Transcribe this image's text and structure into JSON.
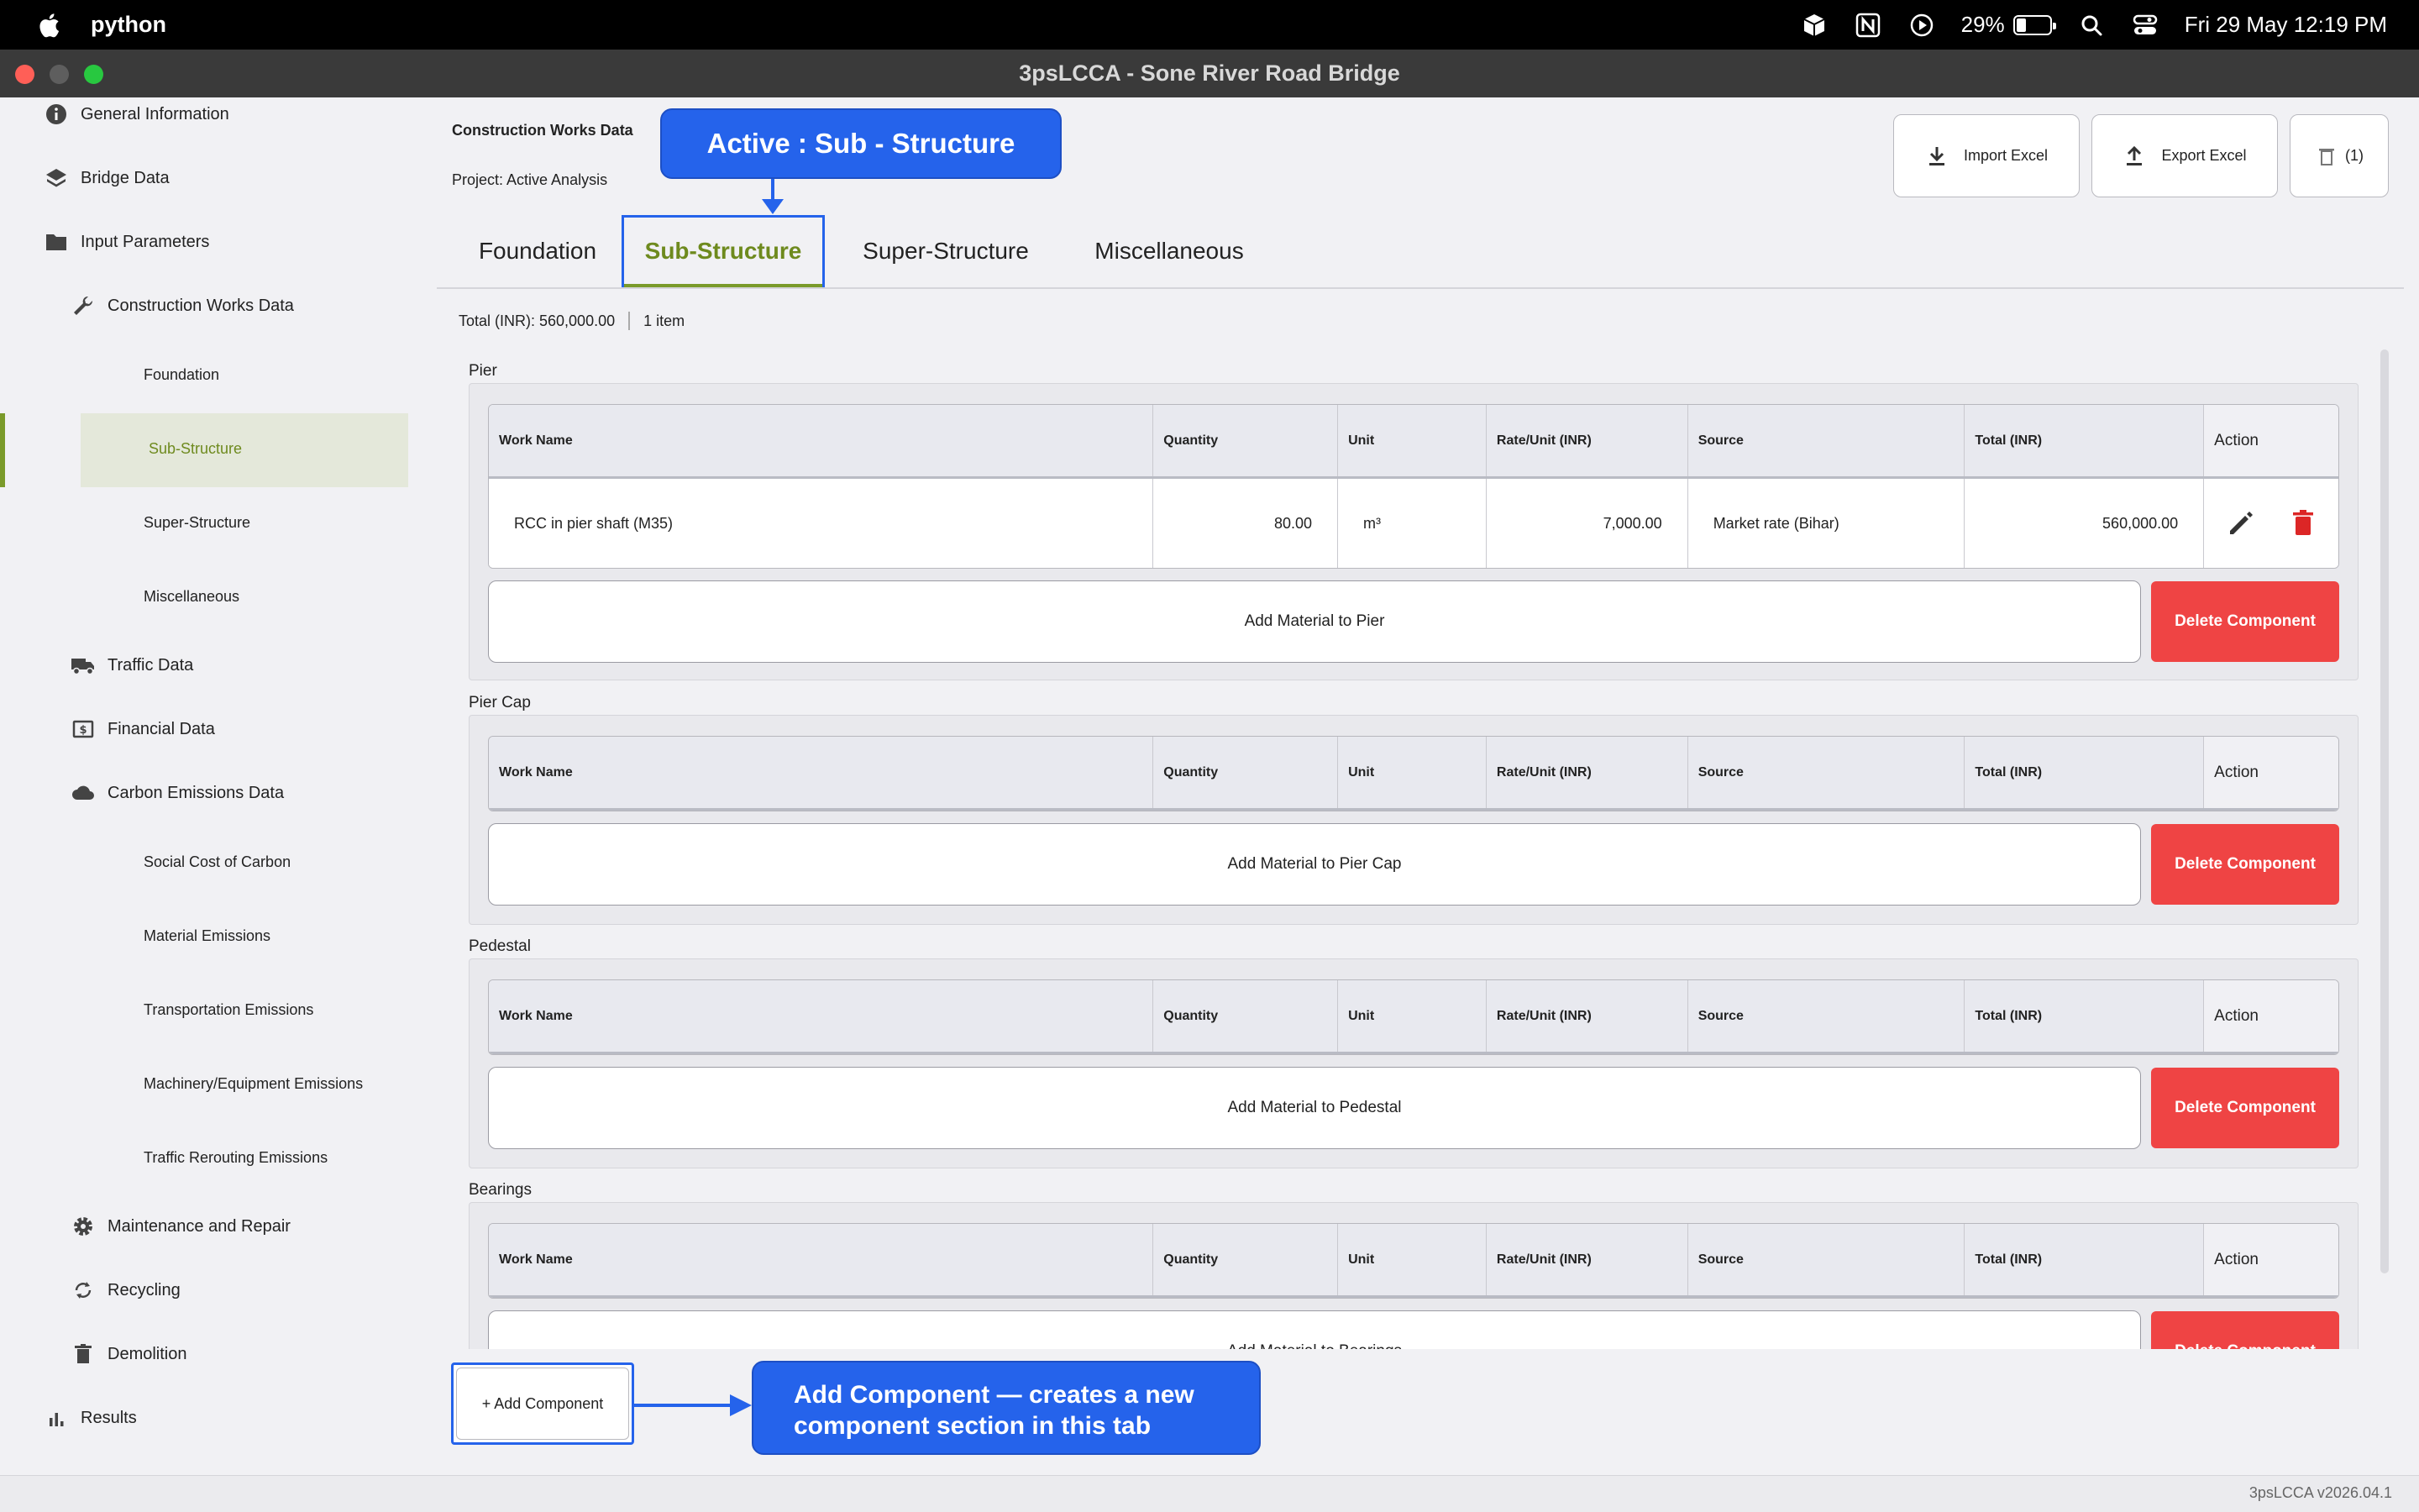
{
  "menubar": {
    "app_name": "python",
    "battery_percent": "29%",
    "battery_level": 0.29,
    "datetime": "Fri 29 May  12:19 PM",
    "icons": [
      "apple-icon",
      "cube-icon",
      "notion-icon",
      "play-circle-icon",
      "battery-icon",
      "search-icon",
      "control-center-icon"
    ]
  },
  "window": {
    "title": "3psLCCA - Sone River Road Bridge"
  },
  "sidebar": {
    "general_information": "General Information",
    "bridge_data": "Bridge Data",
    "input_parameters": "Input Parameters",
    "construction_works_data": "Construction Works Data",
    "foundation": "Foundation",
    "sub_structure": "Sub-Structure",
    "super_structure": "Super-Structure",
    "miscellaneous": "Miscellaneous",
    "traffic_data": "Traffic Data",
    "financial_data": "Financial Data",
    "carbon_emissions_data": "Carbon Emissions Data",
    "social_cost_of_carbon": "Social Cost of Carbon",
    "material_emissions": "Material Emissions",
    "transportation_emissions": "Transportation Emissions",
    "machinery_emissions": "Machinery/Equipment Emissions",
    "traffic_rerouting_emissions": "Traffic Rerouting Emissions",
    "maintenance_and_repair": "Maintenance and Repair",
    "recycling": "Recycling",
    "demolition": "Demolition",
    "results": "Results"
  },
  "header": {
    "title": "Construction Works Data",
    "project": "Project: Active Analysis"
  },
  "toolbar": {
    "import_label": "Import Excel",
    "export_label": "Export Excel",
    "trash_count": "(1)"
  },
  "callouts": {
    "active_tab": "Active :  Sub - Structure",
    "add_component_line1": "Add Component — creates a new",
    "add_component_line2": "component section in this tab"
  },
  "tabs": {
    "foundation": "Foundation",
    "sub_structure": "Sub-Structure",
    "super_structure": "Super-Structure",
    "miscellaneous": "Miscellaneous"
  },
  "summary": {
    "total": "Total (INR): 560,000.00",
    "items": "1 item"
  },
  "columns": {
    "work_name": "Work Name",
    "quantity": "Quantity",
    "unit": "Unit",
    "rate": "Rate/Unit (INR)",
    "source": "Source",
    "total": "Total (INR)",
    "action": "Action"
  },
  "sections": {
    "pier": {
      "label": "Pier",
      "row": {
        "work_name": "RCC in pier shaft (M35)",
        "quantity": "80.00",
        "unit": "m³",
        "rate": "7,000.00",
        "source": "Market rate (Bihar)",
        "total": "560,000.00"
      },
      "add_label": "Add Material to Pier",
      "delete_label": "Delete Component"
    },
    "pier_cap": {
      "label": "Pier Cap",
      "add_label": "Add Material to Pier Cap",
      "delete_label": "Delete Component"
    },
    "pedestal": {
      "label": "Pedestal",
      "add_label": "Add Material to Pedestal",
      "delete_label": "Delete Component"
    },
    "bearings": {
      "label": "Bearings",
      "add_label": "Add Material to Bearings",
      "delete_label": "Delete Component"
    }
  },
  "add_component_label": "+ Add Component",
  "footer": {
    "version": "3psLCCA v2026.04.1"
  },
  "colors": {
    "accent_blue": "#2563eb",
    "active_green": "#6e8a1e",
    "delete_red": "#ef4444"
  }
}
